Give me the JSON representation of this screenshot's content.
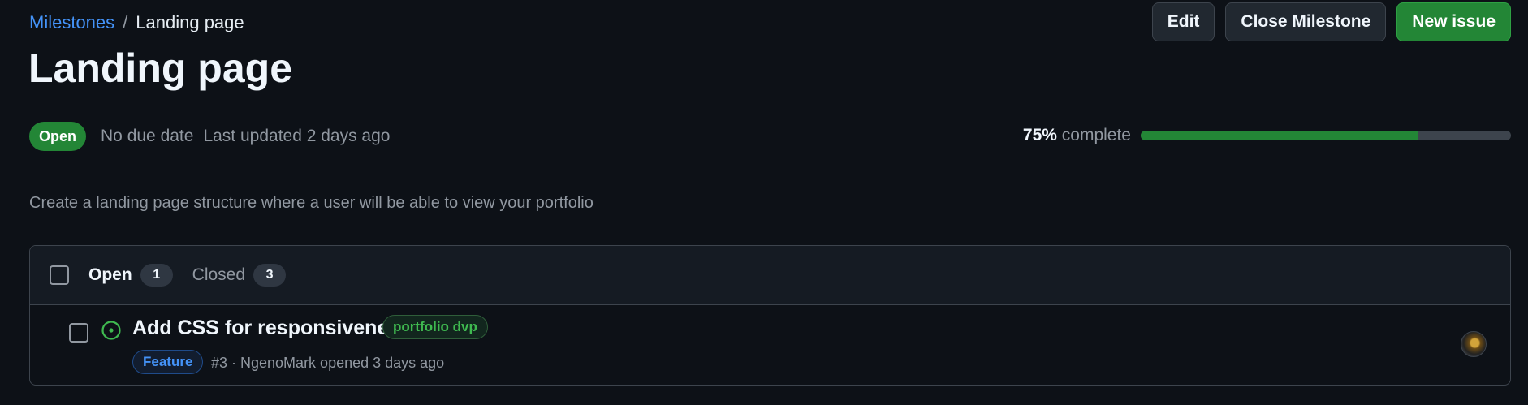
{
  "breadcrumb": {
    "parent": "Milestones",
    "separator": "/",
    "current": "Landing page"
  },
  "actions": {
    "edit": "Edit",
    "close": "Close Milestone",
    "new_issue": "New issue"
  },
  "title": "Landing page",
  "meta": {
    "state": "Open",
    "due": "No due date",
    "updated": "Last updated 2 days ago"
  },
  "progress": {
    "percent_text": "75%",
    "suffix": "complete",
    "value": 75
  },
  "description": "Create a landing page structure where a user will be able to view your portfolio",
  "issues": {
    "filters": {
      "open_label": "Open",
      "open_count": "1",
      "closed_label": "Closed",
      "closed_count": "3"
    },
    "items": [
      {
        "title": "Add CSS for responsiveness",
        "label": "portfolio dvp",
        "type": "Feature",
        "meta": "#3 · NgenoMark opened 3 days ago",
        "state_color": "#3fb950",
        "label_color": "#3fb950",
        "type_color": "#4493f8"
      }
    ]
  },
  "colors": {
    "accent": "#4493f8",
    "success": "#238636",
    "background": "#0d1117"
  }
}
